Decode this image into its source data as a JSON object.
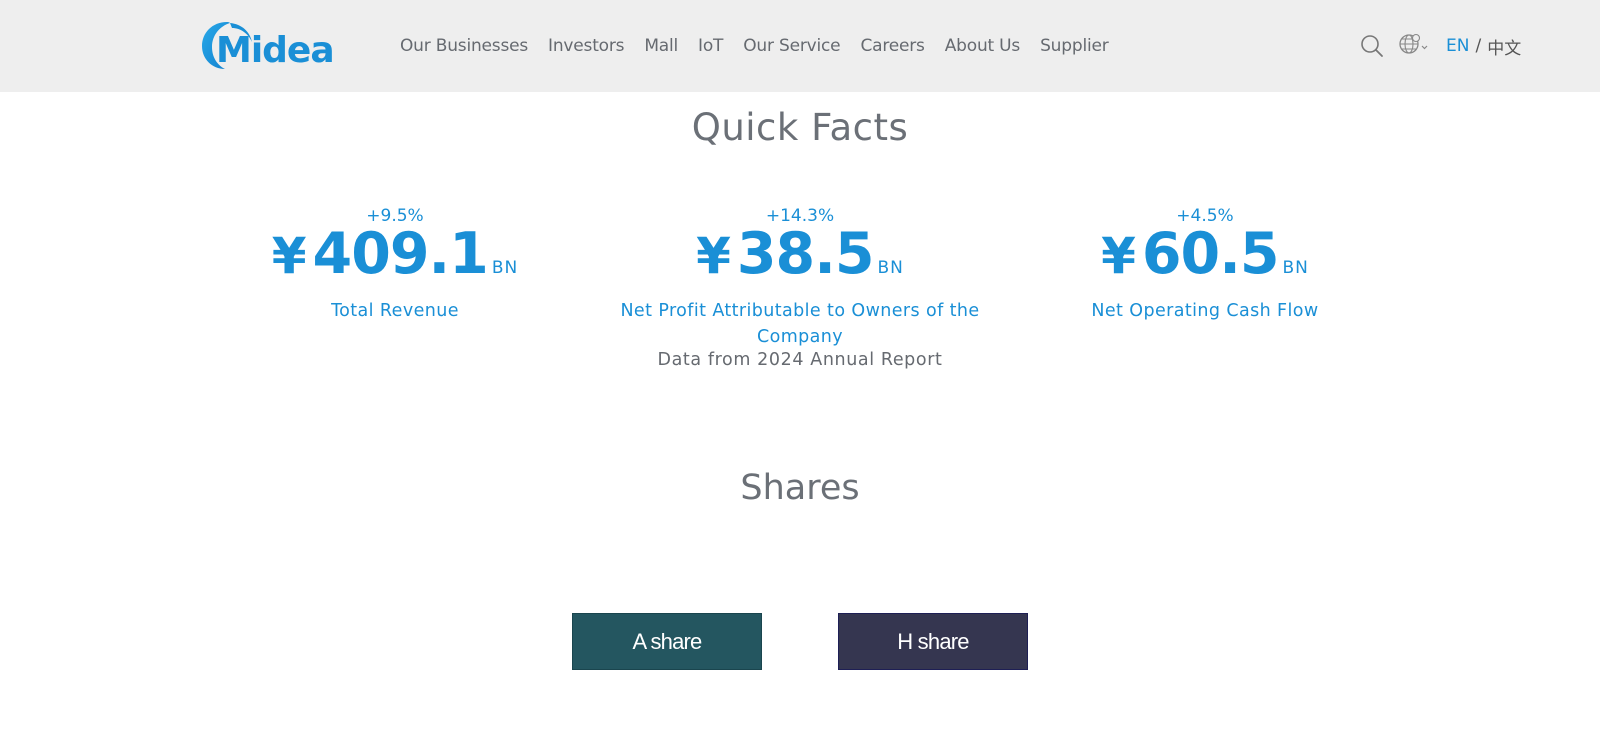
{
  "header": {
    "logo_text": "Midea",
    "nav": [
      {
        "label": "Our Businesses"
      },
      {
        "label": "Investors"
      },
      {
        "label": "Mall"
      },
      {
        "label": "IoT"
      },
      {
        "label": "Our Service"
      },
      {
        "label": "Careers"
      },
      {
        "label": "About Us"
      },
      {
        "label": "Supplier"
      }
    ],
    "lang": {
      "en": "EN",
      "separator": "/",
      "cn": "中文"
    },
    "icons": [
      "search-icon",
      "globe-icon"
    ]
  },
  "quick_facts": {
    "title": "Quick Facts",
    "facts": [
      {
        "change": "+9.5%",
        "currency": "¥",
        "value": "409.1",
        "unit": "BN",
        "label": "Total Revenue"
      },
      {
        "change": "+14.3%",
        "currency": "¥",
        "value": "38.5",
        "unit": "BN",
        "label": "Net Profit Attributable to Owners of the Company"
      },
      {
        "change": "+4.5%",
        "currency": "¥",
        "value": "60.5",
        "unit": "BN",
        "label": "Net Operating Cash Flow"
      }
    ],
    "source": "Data from 2024 Annual Report"
  },
  "shares": {
    "title": "Shares",
    "a_share": "A share",
    "h_share": "H share"
  },
  "colors": {
    "brand_blue": "#1a8fd6",
    "header_bg": "#eeeeee",
    "a_share_bg": "#245660",
    "h_share_bg": "#353650",
    "title_gray": "#6b7077"
  }
}
